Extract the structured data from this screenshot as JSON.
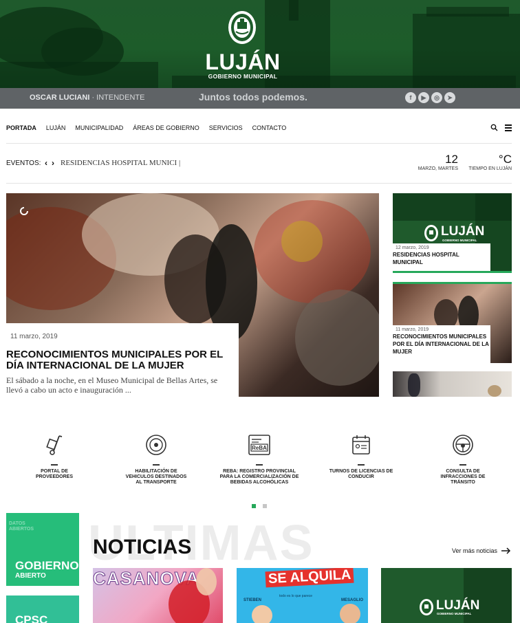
{
  "header": {
    "logo_text": "LUJÁN",
    "logo_subtitle": "GOBIERNO MUNICIPAL",
    "mayor_name": "OSCAR LUCIANI",
    "mayor_role": "· INTENDENTE",
    "slogan": "Juntos todos podemos.",
    "social_icons": [
      "facebook-icon",
      "youtube-icon",
      "instagram-icon",
      "telegram-icon"
    ]
  },
  "nav": {
    "items": [
      "PORTADA",
      "LUJÁN",
      "MUNICIPALIDAD",
      "ÁREAS DE GOBIERNO",
      "SERVICIOS",
      "CONTACTO"
    ],
    "active": "PORTADA"
  },
  "events": {
    "label": "EVENTOS:",
    "ticker_text": "RESIDENCIAS HOSPITAL MUNICI |",
    "day": "12",
    "date_label": "MARZO, MARTES",
    "temperature": "°C",
    "weather_label": "TIEMPO EN LUJÁN"
  },
  "featured": {
    "date": "11 marzo, 2019",
    "title": "RECONOCIMIENTOS MUNICIPALES POR EL DÍA INTERNACIONAL DE LA MUJER",
    "excerpt": "El sábado a la noche, en el Museo Municipal de Bellas Artes, se llevó a cabo un acto e inauguración ..."
  },
  "side_news": [
    {
      "date": "12 marzo, 2019",
      "title": "RESIDENCIAS HOSPITAL MUNICIPAL",
      "logo_text": "LUJÁN",
      "logo_subtitle": "GOBIERNO MUNICIPAL"
    },
    {
      "date": "11 marzo, 2019",
      "title": "RECONOCIMIENTOS MUNICIPALES POR EL DÍA INTERNACIONAL DE LA MUJER"
    }
  ],
  "services": [
    {
      "label": "PORTAL DE PROVEEDORES",
      "icon": "hand-truck-icon"
    },
    {
      "label": "HABILITACIÓN DE VEHICULOS DESTINADOS AL TRANSPORTE",
      "icon": "tire-icon"
    },
    {
      "label": "REBA: REGISTRO PROVINCIAL PARA LA COMERCIALIZACIÓN DE BEBIDAS ALCOHÓLICAS",
      "icon": "reba-card-icon",
      "icon_text": "ReBA"
    },
    {
      "label": "TURNOS DE LICENCIAS DE CONDUCIR",
      "icon": "calendar-id-icon"
    },
    {
      "label": "CONSULTA DE INFRACCIONES DE TRÁNSITO",
      "icon": "steering-wheel-icon"
    }
  ],
  "banners": [
    {
      "small": "DATOS ABIERTOS",
      "title": "GOBIERNO",
      "subtitle": "ABIERTO"
    },
    {
      "title": "CPSC"
    }
  ],
  "news_section": {
    "bg_word": "ULTIMAS",
    "title": "NOTICIAS",
    "more_label": "Ver más noticias"
  },
  "news_thumbs": [
    {
      "title": "CASANOVA"
    },
    {
      "title": "SE ALQUILA",
      "tagline": "todo es lo que parece",
      "left_name": "STIEBEN",
      "right_name": "MESAGLIO"
    },
    {
      "logo_text": "LUJÁN",
      "logo_subtitle": "GOBIERNO MUNICIPAL"
    }
  ],
  "colors": {
    "brand_green": "#1d5c2a",
    "bar_gray": "#5f6366",
    "accent_green": "#26bd7a",
    "dot_active": "#26a85a"
  }
}
